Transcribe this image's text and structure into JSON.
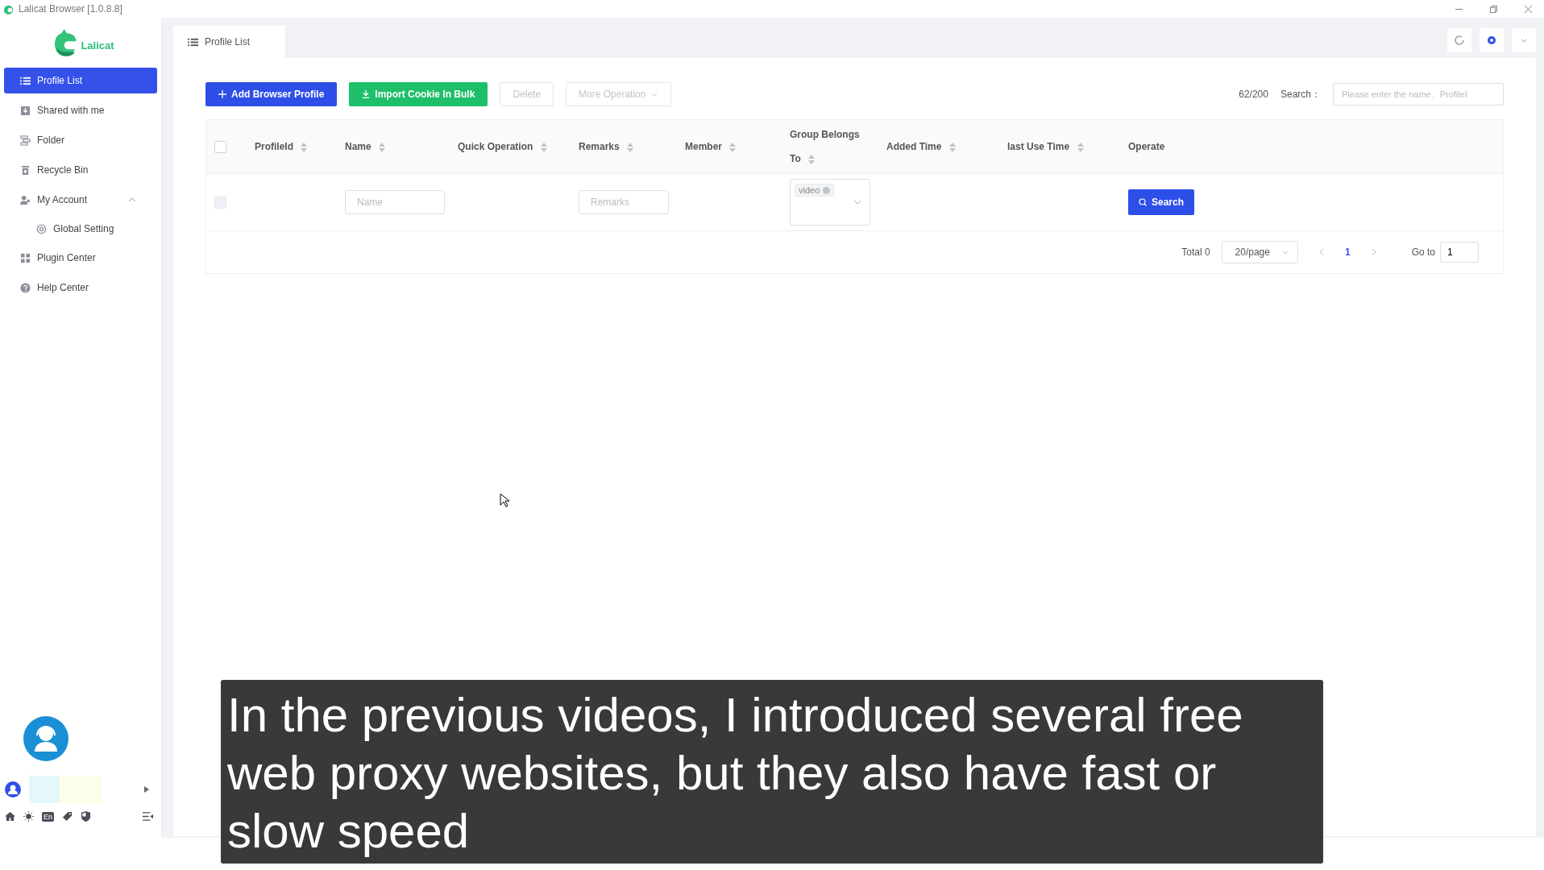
{
  "window": {
    "title": "Lalicat Browser  [1.0.8.8]"
  },
  "logo": {
    "text": "Lalicat"
  },
  "sidebar": {
    "items": [
      {
        "label": "Profile List",
        "selected": true
      },
      {
        "label": "Shared with me",
        "selected": false
      },
      {
        "label": "Folder",
        "selected": false
      },
      {
        "label": "Recycle Bin",
        "selected": false
      },
      {
        "label": "My Account",
        "selected": false,
        "expanded": true,
        "children": [
          {
            "label": "Global Setting",
            "selected": false
          }
        ]
      },
      {
        "label": "Plugin Center",
        "selected": false
      },
      {
        "label": "Help Center",
        "selected": false
      }
    ]
  },
  "footer": {
    "language": "En"
  },
  "tabs": [
    {
      "label": "Profile List",
      "selected": true
    }
  ],
  "toolbar": {
    "buttons": [
      {
        "label": "Add Browser Profile",
        "kind": "primary",
        "disabled": false
      },
      {
        "label": "Import Cookie In Bulk",
        "kind": "success",
        "disabled": false
      },
      {
        "label": "Delete",
        "kind": "plain",
        "disabled": true
      },
      {
        "label": "More Operation",
        "kind": "dropdown",
        "disabled": true
      }
    ],
    "count": "62/200",
    "search_label": "Search：",
    "search": {
      "placeholder": "Please enter the name、ProfileI"
    }
  },
  "table": {
    "select_all": {
      "checked": false
    },
    "columns": [
      {
        "label": "ProfileId",
        "sortable": true
      },
      {
        "label": "Name",
        "sortable": true
      },
      {
        "label": "Quick Operation",
        "sortable": true
      },
      {
        "label": "Remarks",
        "sortable": true
      },
      {
        "label": "Member",
        "sortable": true
      },
      {
        "label": "Group Belongs To",
        "sortable": true
      },
      {
        "label": "Added Time",
        "sortable": true
      },
      {
        "label": "last Use Time",
        "sortable": true
      },
      {
        "label": "Operate",
        "sortable": false
      }
    ],
    "filter_row": {
      "checkbox": {
        "disabled": true
      },
      "name": {
        "placeholder": "Name"
      },
      "remarks": {
        "placeholder": "Remarks"
      },
      "group_tags": [
        "video"
      ],
      "search_button": "Search"
    }
  },
  "pagination": {
    "total": "Total 0",
    "page_size": "20/page",
    "pages": [
      {
        "label": "1",
        "selected": true
      }
    ],
    "goto_label": "Go to",
    "goto_value": "1"
  },
  "subtitle": "In the previous videos, I introduced several free web proxy websites, but they also have fast or slow speed"
}
